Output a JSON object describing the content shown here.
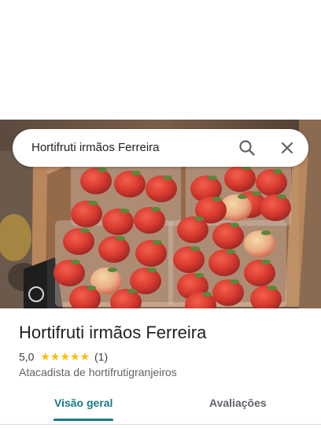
{
  "search": {
    "query": "Hortifruti irmãos Ferreira",
    "search_icon": "search-icon",
    "close_icon": "close-icon"
  },
  "place": {
    "photo_description_icon": "place-photo",
    "name": "Hortifruti irmãos Ferreira",
    "rating": "5,0",
    "stars": "★★★★★",
    "review_count": "(1)",
    "category": "Atacadista de hortifrutigranjeiros"
  },
  "tabs": [
    {
      "label": "Visão geral",
      "active": true
    },
    {
      "label": "Avaliações",
      "active": false
    }
  ],
  "colors": {
    "accent": "#1a7a83",
    "star": "#fbbc04"
  }
}
